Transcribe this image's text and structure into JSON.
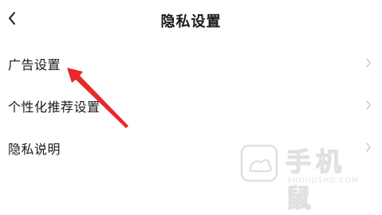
{
  "header": {
    "title": "隐私设置",
    "back_icon": "chevron-left-icon"
  },
  "settings": {
    "items": [
      {
        "label": "广告设置"
      },
      {
        "label": "个性化推荐设置"
      },
      {
        "label": "隐私说明"
      }
    ],
    "chevron_icon": "chevron-right-icon"
  },
  "watermark": {
    "brand": "手机鼠",
    "domain": "SHOUJISHU.COM"
  },
  "annotation": {
    "arrow_color": "#e8282a"
  }
}
